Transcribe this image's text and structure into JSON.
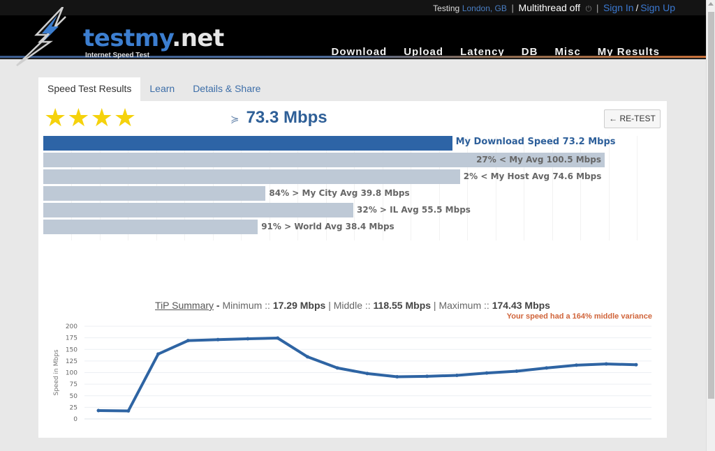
{
  "topbar": {
    "testing_label": "Testing",
    "location": "London, GB",
    "multithread": "Multithread off",
    "power_icon": "power-icon",
    "sign_in": "Sign In",
    "sign_up": "Sign Up",
    "separator": "|",
    "slash": "/"
  },
  "logo": {
    "part1": "testmy",
    "part2": ".net",
    "tagline": "Internet Speed Test",
    "icon": "lightning-bolt-icon"
  },
  "nav": {
    "items": [
      {
        "label": "Download"
      },
      {
        "label": "Upload"
      },
      {
        "label": "Latency"
      },
      {
        "label": "DB"
      },
      {
        "label": "Misc"
      },
      {
        "label": "My Results"
      }
    ]
  },
  "tabs": [
    {
      "label": "Speed Test Results",
      "active": true
    },
    {
      "label": "Learn",
      "active": false
    },
    {
      "label": "Details & Share",
      "active": false
    }
  ],
  "result": {
    "rating_stars": 4,
    "rating_max": 4,
    "star_glyph": "★",
    "chevron_glyph": "≽",
    "speed": "73.3 Mbps",
    "retest_label": "← RE-TEST"
  },
  "comparison": {
    "scale_max_mbps": 110,
    "bars": [
      {
        "value": 73.2,
        "label": "My Download Speed 73.2 Mbps",
        "primary": true
      },
      {
        "value": 100.5,
        "label": "27% < My Avg 100.5 Mbps",
        "primary": false
      },
      {
        "value": 74.6,
        "label": "2% < My Host Avg 74.6 Mbps",
        "primary": false
      },
      {
        "value": 39.8,
        "label": "84% > My City Avg 39.8 Mbps",
        "primary": false
      },
      {
        "value": 55.5,
        "label": "32% > IL Avg 55.5 Mbps",
        "primary": false
      },
      {
        "value": 38.4,
        "label": "91% > World Avg 38.4 Mbps",
        "primary": false
      }
    ]
  },
  "tip": {
    "link": "TiP Summary",
    "dash": " - ",
    "min_label": "Minimum :: ",
    "min_value": "17.29 Mbps",
    "mid_label": " | Middle :: ",
    "mid_value": "118.55 Mbps",
    "max_label": " | Maximum :: ",
    "max_value": "174.43 Mbps",
    "variance": "Your speed had a 164% middle variance"
  },
  "chart_data": {
    "type": "line",
    "title": "",
    "xlabel": "",
    "ylabel": "Speed in Mbps",
    "ylim": [
      0,
      200
    ],
    "yticks": [
      0,
      25,
      50,
      75,
      100,
      125,
      150,
      175,
      200
    ],
    "grid": true,
    "legend": "none",
    "color": "#2e64a3",
    "x": [
      1,
      2,
      3,
      4,
      5,
      6,
      7,
      8,
      9,
      10,
      11,
      12,
      13,
      14,
      15,
      16,
      17,
      18,
      19
    ],
    "series": [
      {
        "name": "Speed",
        "values": [
          18,
          17.29,
          140,
          169,
          171,
          173,
          174.43,
          134,
          110,
          98,
          91,
          92,
          94,
          99,
          103,
          110,
          116,
          118.55,
          117
        ]
      }
    ]
  }
}
